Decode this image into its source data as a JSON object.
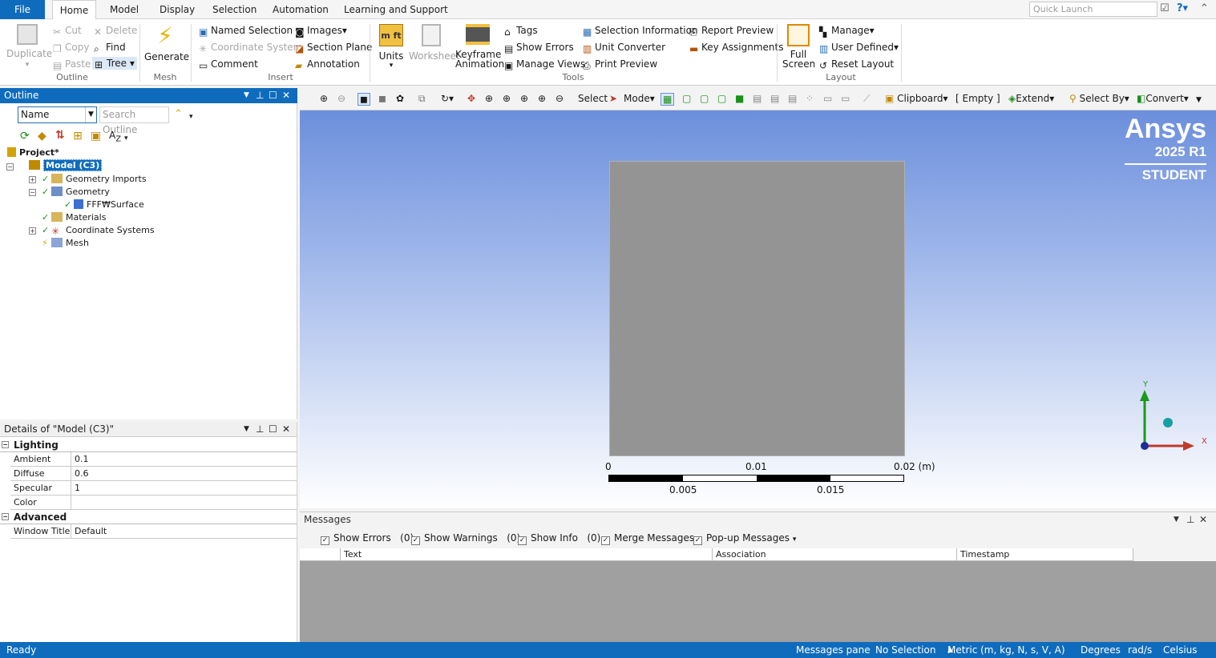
{
  "menu": {
    "file": "File",
    "tabs": [
      "Home",
      "Model",
      "Display",
      "Selection",
      "Automation",
      "Learning and Support"
    ],
    "quick_launch_placeholder": "Quick Launch"
  },
  "ribbon": {
    "outline_group": {
      "duplicate": "Duplicate",
      "cut": "Cut",
      "delete": "Delete",
      "copy": "Copy",
      "find": "Find",
      "paste": "Paste",
      "tree": "Tree",
      "label": "Outline"
    },
    "mesh_group": {
      "generate": "Generate",
      "label": "Mesh"
    },
    "insert_group": {
      "named_selection": "Named Selection",
      "images": "Images",
      "coordinate_system": "Coordinate System",
      "section_plane": "Section Plane",
      "comment": "Comment",
      "annotation": "Annotation",
      "label": "Insert"
    },
    "tools_group": {
      "units": "Units",
      "worksheet": "Worksheet",
      "keyframe_line1": "Keyframe",
      "keyframe_line2": "Animation",
      "tags": "Tags",
      "show_errors": "Show Errors",
      "manage_views": "Manage Views",
      "selection_information": "Selection Information",
      "unit_converter": "Unit Converter",
      "print_preview": "Print Preview",
      "report_preview": "Report Preview",
      "key_assignments": "Key Assignments",
      "label": "Tools"
    },
    "layout_group": {
      "full_screen_line1": "Full",
      "full_screen_line2": "Screen",
      "manage": "Manage",
      "user_defined": "User Defined",
      "reset_layout": "Reset Layout",
      "label": "Layout"
    }
  },
  "outline": {
    "title": "Outline",
    "filter_value": "Name",
    "search_placeholder": "Search Outline",
    "tree": {
      "project": "Project*",
      "model": "Model (C3)",
      "geometry_imports": "Geometry Imports",
      "geometry": "Geometry",
      "surface": "FFF₩Surface",
      "materials": "Materials",
      "coordinate_systems": "Coordinate Systems",
      "mesh": "Mesh"
    }
  },
  "details": {
    "title": "Details of \"Model (C3)\"",
    "sections": {
      "lighting": "Lighting",
      "advanced": "Advanced"
    },
    "rows": {
      "ambient": {
        "k": "Ambient",
        "v": "0.1"
      },
      "diffuse": {
        "k": "Diffuse",
        "v": "0.6"
      },
      "specular": {
        "k": "Specular",
        "v": "1"
      },
      "color": {
        "k": "Color",
        "v": ""
      },
      "window_title": {
        "k": "Window Title",
        "v": "Default"
      }
    }
  },
  "graphics_toolbar": {
    "select": "Select",
    "mode": "Mode",
    "clipboard": "Clipboard",
    "empty": "[ Empty ]",
    "extend": "Extend",
    "select_by": "Select By",
    "convert": "Convert"
  },
  "viewport": {
    "brand": "Ansys",
    "version": "2025 R1",
    "edition": "STUDENT",
    "scale_top": [
      "0",
      "0.01",
      "0.02 (m)"
    ],
    "scale_bottom": [
      "0.005",
      "0.015"
    ],
    "axis_x": "X",
    "axis_y": "Y"
  },
  "messages": {
    "title": "Messages",
    "options": {
      "show_errors": "Show Errors",
      "errors_count": "(0)",
      "show_warnings": "Show Warnings",
      "warnings_count": "(0)",
      "show_info": "Show Info",
      "info_count": "(0)",
      "merge": "Merge Messages",
      "popup": "Pop-up Messages"
    },
    "columns": {
      "text": "Text",
      "association": "Association",
      "timestamp": "Timestamp"
    }
  },
  "status": {
    "ready": "Ready",
    "messages_pane": "Messages pane",
    "selection": "No Selection",
    "units": "Metric (m, kg, N, s, V, A)",
    "angle": "Degrees",
    "rate": "rad/s",
    "temp": "Celsius"
  },
  "colors": {
    "accent": "#0f6cbd",
    "plate": "#949494",
    "bg_top": "#6c8fdc"
  }
}
